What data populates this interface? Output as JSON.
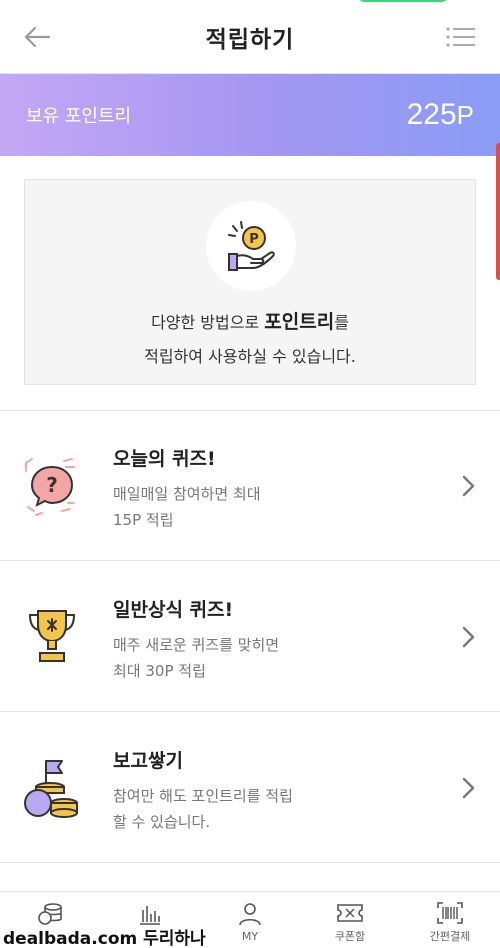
{
  "header": {
    "title": "적립하기"
  },
  "banner": {
    "label": "보유 포인트리",
    "value": "225",
    "unit": "P"
  },
  "info": {
    "line1_prefix": "다양한 방법으로 ",
    "line1_bold": "포인트리",
    "line1_suffix": "를",
    "line2": "적립하여 사용하실 수 있습니다.",
    "coin_letter": "P"
  },
  "rows": [
    {
      "title": "오늘의 퀴즈!",
      "desc1": "매일매일 참여하면 최대",
      "desc2": "15P 적립"
    },
    {
      "title": "일반상식 퀴즈!",
      "desc1": "매주 새로운 퀴즈를 맞히면",
      "desc2": "최대 30P 적립"
    },
    {
      "title": "보고쌓기",
      "desc1": "참여만 해도 포인트리를 적립",
      "desc2": "할 수 있습니다."
    }
  ],
  "nav": [
    {
      "label": ""
    },
    {
      "label": ""
    },
    {
      "label": "MY"
    },
    {
      "label": "쿠폰함"
    },
    {
      "label": "간편결제"
    }
  ],
  "watermark": "dealbada.com 두리하나",
  "colors": {
    "accent": "#a396f1",
    "gold": "#f3c54b",
    "pink": "#f4a6a6",
    "lavender": "#b8a9f0"
  }
}
